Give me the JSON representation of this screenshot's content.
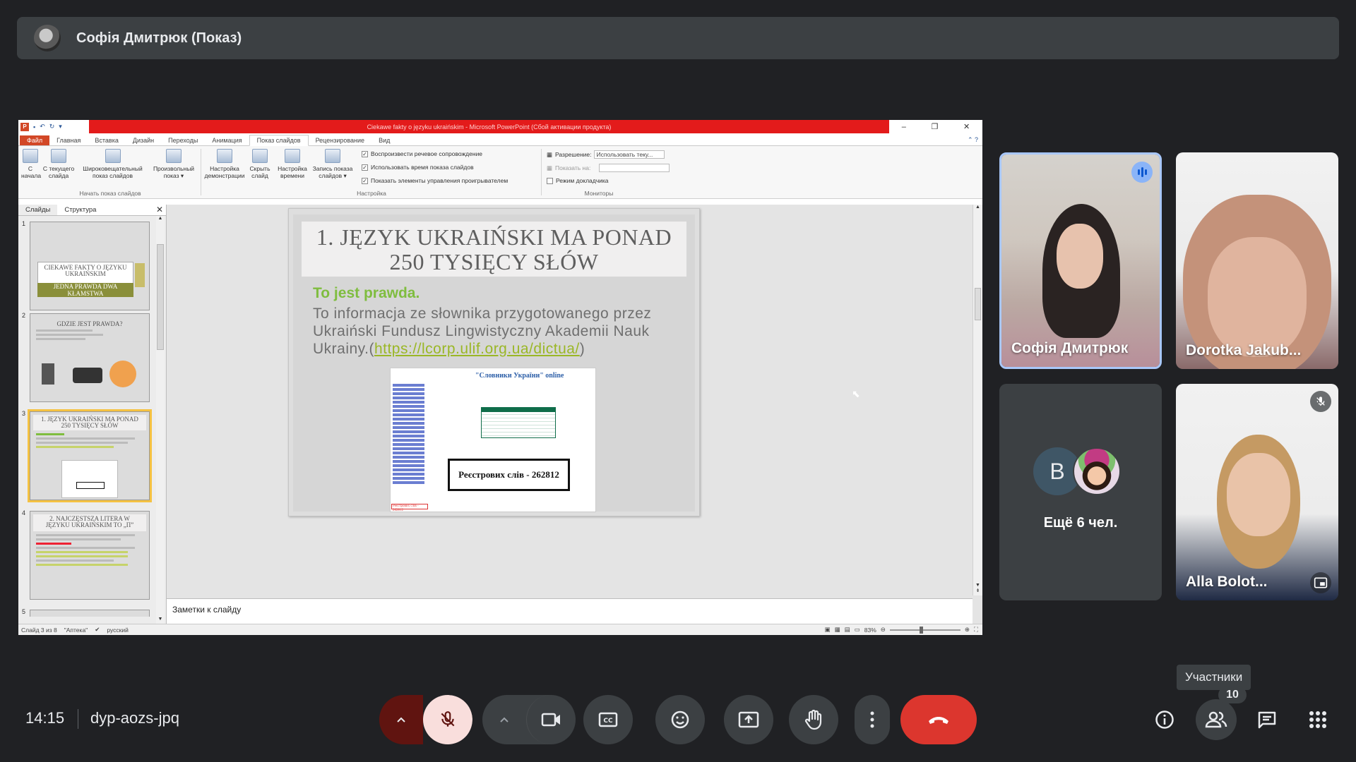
{
  "presenter": {
    "name": "Софія Дмитрюк (Показ)"
  },
  "ppt": {
    "window_title": "Ciekawe fakty o języku ukraińskim  -  Microsoft PowerPoint (Сбой активации продукта)",
    "tabs": [
      "Файл",
      "Главная",
      "Вставка",
      "Дизайн",
      "Переходы",
      "Анимация",
      "Показ слайдов",
      "Рецензирование",
      "Вид"
    ],
    "active_tab_index": 6,
    "ribbon": {
      "btn_from_start": "С\nначала",
      "btn_from_current": "С текущего\nслайда",
      "btn_broadcast": "Широковещательный\nпоказ слайдов",
      "btn_custom": "Произвольный\nпоказ ▾",
      "group_start": "Начать показ слайдов",
      "btn_setup": "Настройка\nдемонстрации",
      "btn_hide": "Скрыть\nслайд",
      "btn_timings": "Настройка\nвремени",
      "btn_record": "Запись показа\nслайдов ▾",
      "check_narration": "Воспроизвести речевое сопровождение",
      "check_timings": "Использовать время показа слайдов",
      "check_controls": "Показать элементы управления проигрывателем",
      "group_setup": "Настройка",
      "resolution_label": "Разрешение:",
      "resolution_value": "Использовать теку...",
      "show_on_label": "Показать на:",
      "presenter_view": "Режим докладчика",
      "group_monitors": "Мониторы"
    },
    "panel_tabs": {
      "slides": "Слайды",
      "outline": "Структура"
    },
    "thumbs": [
      {
        "num": "1",
        "title": "CIEKAWE FAKTY O JĘZYKU UKRAIŃSKIM",
        "sub": "JEDNA PRAWDA DWA KŁAMSTWA"
      },
      {
        "num": "2",
        "title": "GDZIE JEST PRAWDA?"
      },
      {
        "num": "3",
        "title": "1. JĘZYK UKRAIŃSKI MA PONAD 250 TYSIĘCY SŁÓW"
      },
      {
        "num": "4",
        "title": "2. NAJCZĘSTSZA LITERA W JĘZYKU UKRAIŃSKIM TO „П”"
      },
      {
        "num": "5",
        "title": ""
      }
    ],
    "slide": {
      "title": "1. JĘZYK UKRAIŃSKI MA PONAD 250 TYSIĘCY SŁÓW",
      "subtitle": "To jest prawda.",
      "body": "To informacja ze słownika przygotowanego przez Ukraiński Fundusz Lingwistyczny Akademii Nauk Ukrainy.(",
      "link": "https://lcorp.ulif.org.ua/dictua/",
      "body_end": ")",
      "shot_title": "\"Словники України\" online",
      "callout": "Реєстрових слів - 262812",
      "shot_red": "Реєстрових слів - 262812"
    },
    "notes_placeholder": "Заметки к слайду",
    "status": {
      "slide": "Слайд 3 из 8",
      "theme": "\"Аптека\"",
      "lang": "русский",
      "zoom": "83%"
    }
  },
  "tiles": [
    {
      "name": "Софія Дмитрюк"
    },
    {
      "name": "Dorotka Jakub..."
    },
    {
      "name": "Alla Bolot..."
    }
  ],
  "more": {
    "initial": "В",
    "label": "Ещё 6 чел."
  },
  "bottom": {
    "time": "14:15",
    "code": "dyp-aozs-jpq",
    "tooltip": "Участники",
    "participants_count": "10"
  }
}
